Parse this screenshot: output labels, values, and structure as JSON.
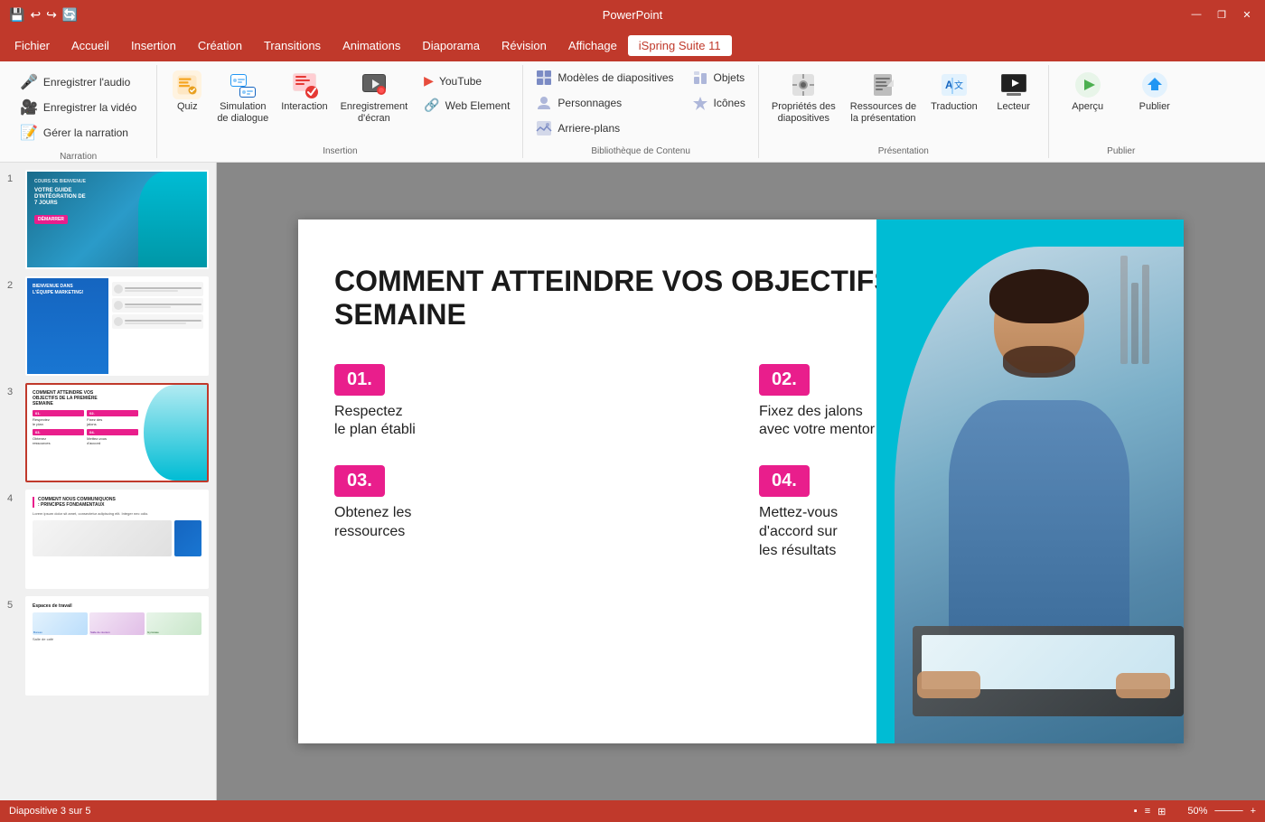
{
  "titleBar": {
    "title": "PowerPoint",
    "controls": {
      "minimize": "—",
      "maximize": "❐",
      "close": "✕"
    }
  },
  "menuBar": {
    "items": [
      {
        "id": "fichier",
        "label": "Fichier"
      },
      {
        "id": "accueil",
        "label": "Accueil"
      },
      {
        "id": "insertion",
        "label": "Insertion"
      },
      {
        "id": "creation",
        "label": "Création"
      },
      {
        "id": "transitions",
        "label": "Transitions"
      },
      {
        "id": "animations",
        "label": "Animations"
      },
      {
        "id": "diaporama",
        "label": "Diaporama"
      },
      {
        "id": "revision",
        "label": "Révision"
      },
      {
        "id": "affichage",
        "label": "Affichage"
      },
      {
        "id": "ispring",
        "label": "iSpring Suite 11",
        "active": true
      }
    ]
  },
  "ribbon": {
    "groups": [
      {
        "id": "narration",
        "label": "Narration",
        "items": [
          {
            "id": "audio",
            "label": "Enregistrer l'audio",
            "icon": "🎤"
          },
          {
            "id": "video",
            "label": "Enregistrer la vidéo",
            "icon": "🎥"
          },
          {
            "id": "narration",
            "label": "Gérer la narration",
            "icon": "🎬"
          }
        ]
      },
      {
        "id": "insertion",
        "label": "Insertion",
        "large_items": [
          {
            "id": "quiz",
            "label": "Quiz",
            "icon": "✅"
          },
          {
            "id": "simulation",
            "label": "Simulation\nde dialogue",
            "icon": "💬"
          },
          {
            "id": "interaction",
            "label": "Interaction",
            "icon": "👆"
          },
          {
            "id": "enregistrement",
            "label": "Enregistrement\nd'écran",
            "icon": "🔴"
          }
        ],
        "small_items": [
          {
            "id": "youtube",
            "label": "YouTube",
            "icon": "▶"
          },
          {
            "id": "web",
            "label": "Web Element",
            "icon": "🔗"
          }
        ]
      },
      {
        "id": "bibliotheque",
        "label": "Bibliothèque de Contenu",
        "items": [
          {
            "id": "modeles",
            "label": "Modèles de diapositives",
            "icon": "🖼"
          },
          {
            "id": "personnages",
            "label": "Personnages",
            "icon": "👤"
          },
          {
            "id": "arrieres",
            "label": "Arriere-plans",
            "icon": "🖼"
          },
          {
            "id": "objets",
            "label": "Objets",
            "icon": "📦"
          },
          {
            "id": "icones",
            "label": "Icônes",
            "icon": "⭐"
          }
        ]
      },
      {
        "id": "presentation",
        "label": "Présentation",
        "items": [
          {
            "id": "proprietes",
            "label": "Propriétés des\ndiapositives",
            "icon": "⚙"
          },
          {
            "id": "ressources",
            "label": "Ressources de\nla présentation",
            "icon": "📎"
          },
          {
            "id": "traduction",
            "label": "Traduction",
            "icon": "🌐"
          },
          {
            "id": "lecteur",
            "label": "Lecteur",
            "icon": "▶"
          }
        ]
      },
      {
        "id": "publier",
        "label": "Publier",
        "items": [
          {
            "id": "apercu",
            "label": "Aperçu",
            "icon": "▶"
          },
          {
            "id": "publier",
            "label": "Publier",
            "icon": "⬆"
          }
        ]
      }
    ]
  },
  "slides": [
    {
      "num": "1",
      "active": false
    },
    {
      "num": "2",
      "active": false
    },
    {
      "num": "3",
      "active": true
    },
    {
      "num": "4",
      "active": false
    },
    {
      "num": "5",
      "active": false
    }
  ],
  "currentSlide": {
    "title": "COMMENT ATTEINDRE VOS OBJECTIFS DE LA PREMIÈRE SEMAINE",
    "items": [
      {
        "badge": "01.",
        "text": "Respectez\nle plan établi"
      },
      {
        "badge": "02.",
        "text": "Fixez des jalons\navec votre mentor"
      },
      {
        "badge": "03.",
        "text": "Obtenez les\nressources"
      },
      {
        "badge": "04.",
        "text": "Mettez-vous\nd'accord sur\nles résultats"
      }
    ]
  },
  "statusBar": {
    "slideInfo": "Diapositive 3 sur 5"
  }
}
